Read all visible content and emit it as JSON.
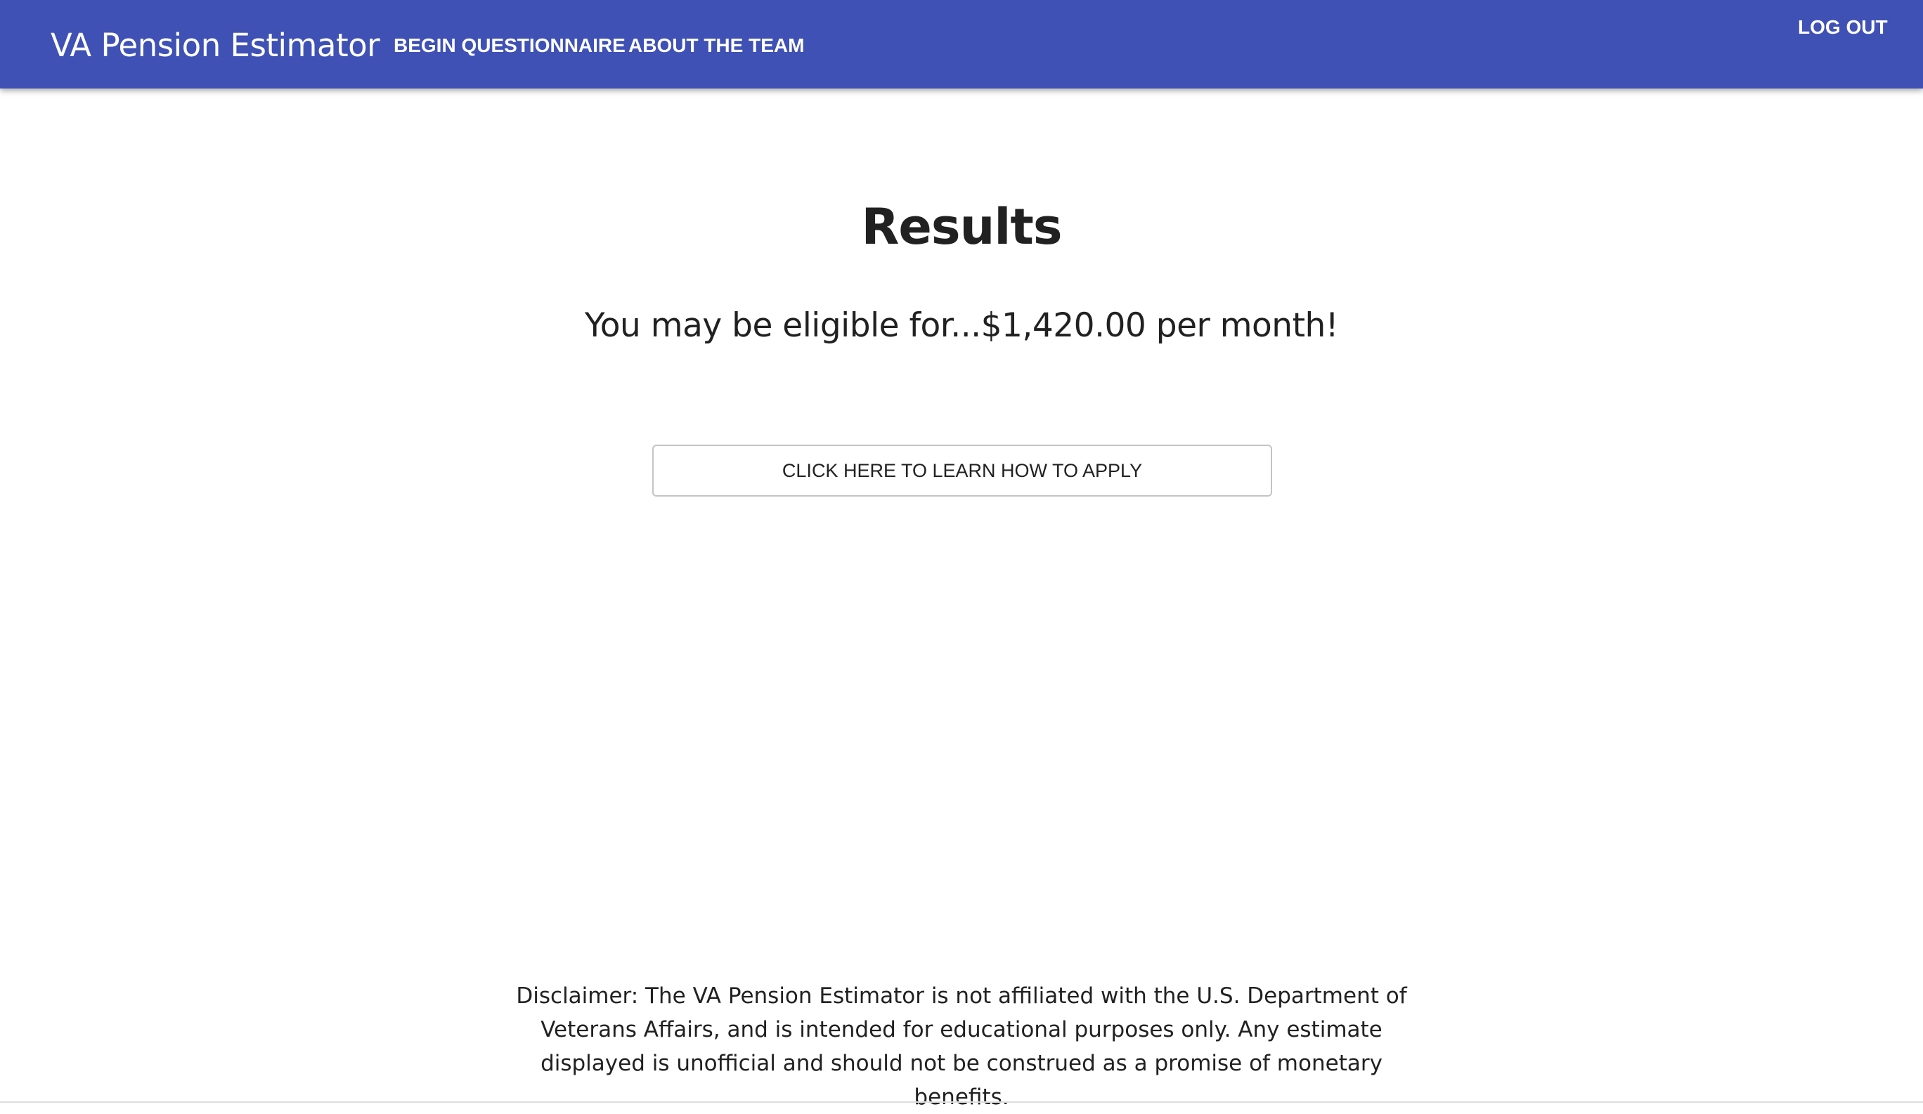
{
  "header": {
    "brand": "VA Pension Estimator",
    "nav": {
      "begin": "BEGIN QUESTIONNAIRE",
      "about": "ABOUT THE TEAM",
      "logout": "LOG OUT"
    },
    "color": "#3f51b5"
  },
  "main": {
    "title": "Results",
    "result_text": "You may be eligible for...$1,420.00 per month!",
    "apply_button": "CLICK HERE TO LEARN HOW TO APPLY"
  },
  "footer": {
    "disclaimer": "Disclaimer: The VA Pension Estimator is not affiliated with the U.S. Department of Veterans Affairs, and is intended for educational purposes only. Any estimate displayed is unofficial and should not be construed as a promise of monetary benefits."
  }
}
